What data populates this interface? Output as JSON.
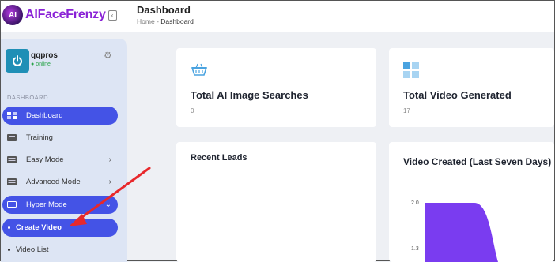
{
  "brand": {
    "name": "AIFaceFrenzy",
    "logo_text": "AI"
  },
  "header": {
    "title": "Dashboard",
    "breadcrumb": [
      "Home",
      "Dashboard"
    ],
    "separator": "-"
  },
  "user": {
    "name": "qqpros",
    "status": "online"
  },
  "sidebar": {
    "section_label": "DASHBOARD",
    "items": [
      {
        "label": "Dashboard",
        "active": true
      },
      {
        "label": "Training"
      },
      {
        "label": "Easy Mode",
        "chevron": "›"
      },
      {
        "label": "Advanced Mode",
        "chevron": "›"
      },
      {
        "label": "Hyper Mode",
        "chevron": "⌄",
        "active": true
      }
    ],
    "sub_items": [
      {
        "label": "Create Video",
        "active": true
      },
      {
        "label": "Video List"
      }
    ]
  },
  "cards": {
    "ai_searches": {
      "title": "Total AI Image Searches",
      "value": "0"
    },
    "videos": {
      "title": "Total Video Generated",
      "value": "17"
    },
    "recent_leads": {
      "title": "Recent Leads"
    },
    "video_chart": {
      "title": "Video Created (Last Seven Days)"
    }
  },
  "chart_data": {
    "type": "area",
    "title": "Video Created (Last Seven Days)",
    "y_ticks": [
      "2.0",
      "1.3"
    ],
    "series": [
      {
        "values": [
          2.0,
          2.0,
          1.2
        ]
      }
    ],
    "color": "#7a3cf0"
  },
  "colors": {
    "accent": "#4453e6",
    "brand": "#8a22d6",
    "arrow": "#e8282b"
  }
}
